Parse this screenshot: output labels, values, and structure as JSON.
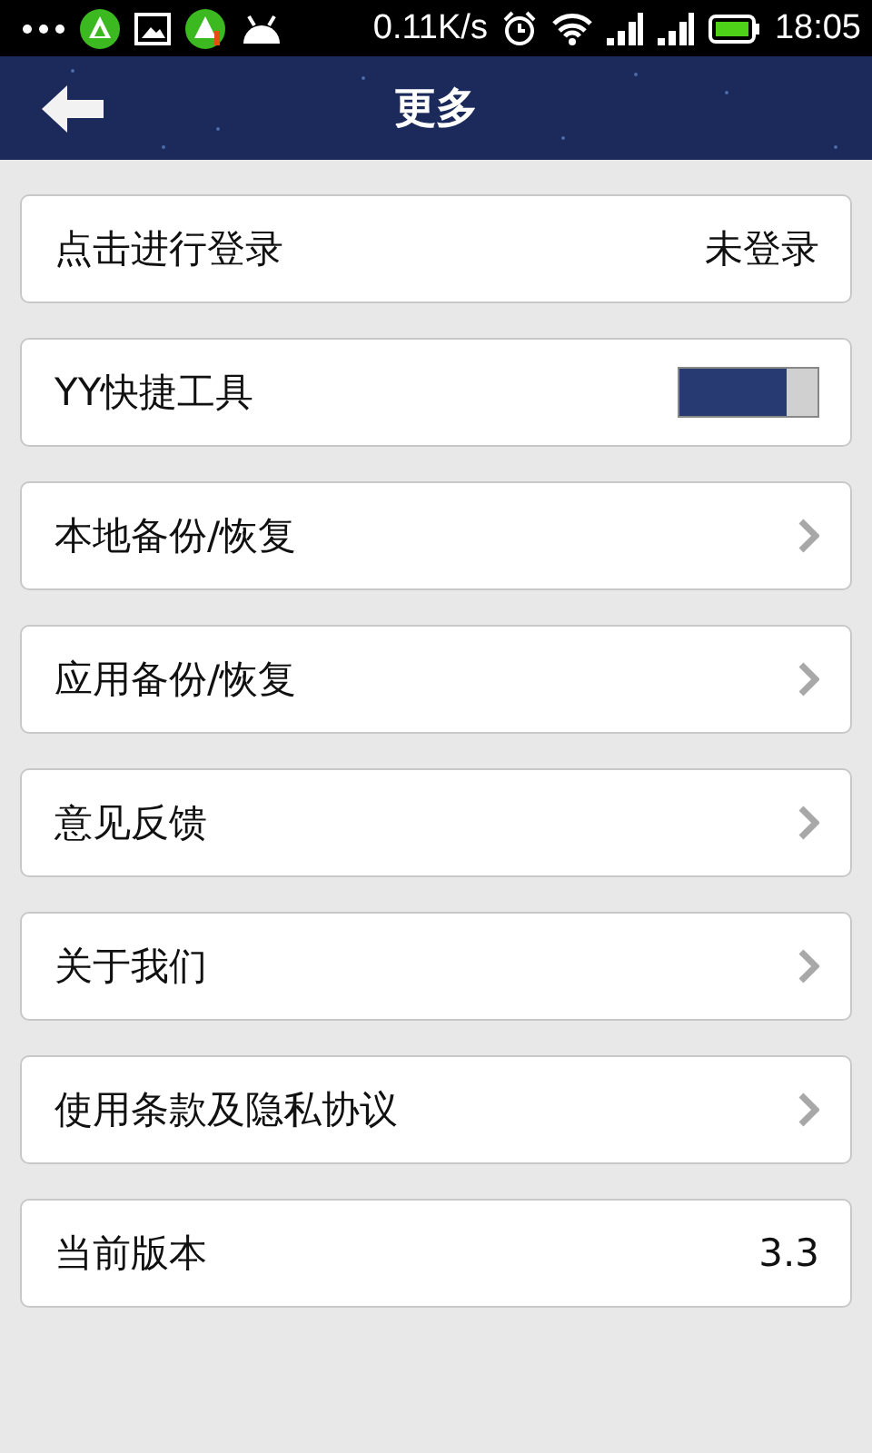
{
  "status_bar": {
    "speed": "0.11K/s",
    "time": "18:05"
  },
  "header": {
    "title": "更多"
  },
  "rows": [
    {
      "kind": "value",
      "label": "点击进行登录",
      "value": "未登录"
    },
    {
      "kind": "toggle",
      "label": "YY快捷工具",
      "on": true
    },
    {
      "kind": "link",
      "label": "本地备份/恢复"
    },
    {
      "kind": "link",
      "label": "应用备份/恢复"
    },
    {
      "kind": "link",
      "label": "意见反馈"
    },
    {
      "kind": "link",
      "label": "关于我们"
    },
    {
      "kind": "link",
      "label": "使用条款及隐私协议"
    },
    {
      "kind": "value",
      "label": "当前版本",
      "value": "3.3"
    }
  ]
}
